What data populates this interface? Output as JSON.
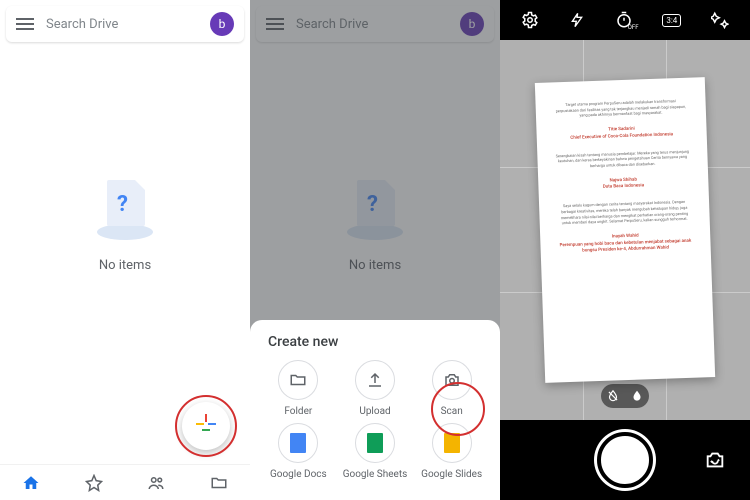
{
  "drive": {
    "search_placeholder": "Search Drive",
    "avatar_initial": "b",
    "no_items": "No items"
  },
  "sheet": {
    "title": "Create new",
    "items": [
      {
        "label": "Folder"
      },
      {
        "label": "Upload"
      },
      {
        "label": "Scan"
      },
      {
        "label": "Google Docs"
      },
      {
        "label": "Google Sheets"
      },
      {
        "label": "Google Slides"
      }
    ]
  },
  "camera": {
    "timer_sub": "OFF",
    "aspect": "3:4"
  },
  "scanned_page": {
    "para1": "Target utama program PerpuSeru adalah melakukan transformasi perpustakaan dari fasilitas yang tak terjangkau menjadi ramah bagi siapapun, yang pada akhirnya bermanfaat bagi masyarakat.",
    "name1": "Titie Sadarini",
    "title1": "Chief Executive of Coca‑Cola Foundation Indonesia",
    "para2": "Serangkaian kisah tentang manusia pembelajar. Mereka yang terus menjunjung keutuhan, dan keras berkeyakinan bahwa pengetahuan Cerita bernyawa yang berharga untuk dibaca dan disebarkan.",
    "name2": "Najwa Shihab",
    "title2": "Duta Baca Indonesia",
    "para3": "Saya selalu kagum dengan cerita tentang masyarakat Indonesia. Dengan berbagai kreativitas, mereka telah banyak mengubah kehidupan hidup, juga memelihara nilai‑nilai berharga dan mengikat perhatian orang‑orang penting untuk memberi daya ungkit. Selamat PerpuSeru, kalian sungguh terhormat.",
    "name3": "Inayah Wahid",
    "title3": "Perempuan yang hobi baca dan kebetulan menjabat sebagai anak bungsu Presiden ke‑4, Abdurrahman Wahid"
  }
}
